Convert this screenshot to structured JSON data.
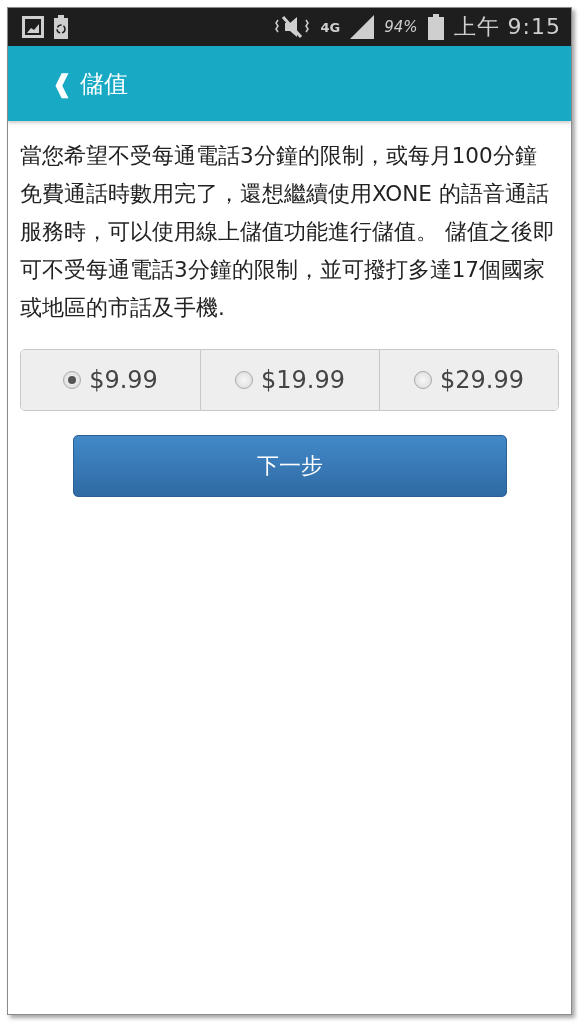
{
  "status_bar": {
    "network": "4G",
    "battery": "94%",
    "time": "上午 9:15"
  },
  "app_bar": {
    "back": "❰",
    "title": "儲值"
  },
  "description": "當您希望不受每通電話3分鐘的限制，或每月100分鐘免費通話時數用完了，還想繼續使用XONE 的語音通話服務時，可以使用線上儲值功能進行儲值。 儲值之後即可不受每通電話3分鐘的限制，並可撥打多達17個國家或地區的市話及手機.",
  "options": [
    {
      "label": "$9.99",
      "selected": true
    },
    {
      "label": "$19.99",
      "selected": false
    },
    {
      "label": "$29.99",
      "selected": false
    }
  ],
  "next_button": "下一步"
}
